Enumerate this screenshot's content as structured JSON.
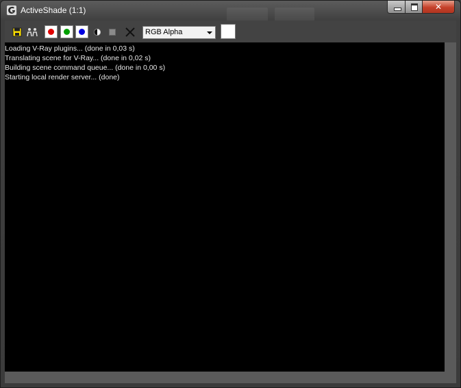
{
  "window": {
    "title": "ActiveShade (1:1)"
  },
  "toolbar": {
    "icons": [
      "save-icon",
      "clone-icon",
      "red-channel-icon",
      "green-channel-icon",
      "blue-channel-icon",
      "alpha-channel-icon",
      "monochrome-icon",
      "clear-icon"
    ],
    "channel_select": {
      "selected": "RGB Alpha"
    },
    "channel_colors": {
      "red": "#e00000",
      "green": "#00a000",
      "blue": "#0000e0"
    },
    "swatch_color": "#ffffff"
  },
  "log": {
    "lines": [
      "Loading V-Ray plugins... (done in 0,03 s)",
      "Translating scene for V-Ray... (done in 0,02 s)",
      "Building scene command queue... (done in 0,00 s)",
      "Starting local render server... (done)"
    ]
  }
}
